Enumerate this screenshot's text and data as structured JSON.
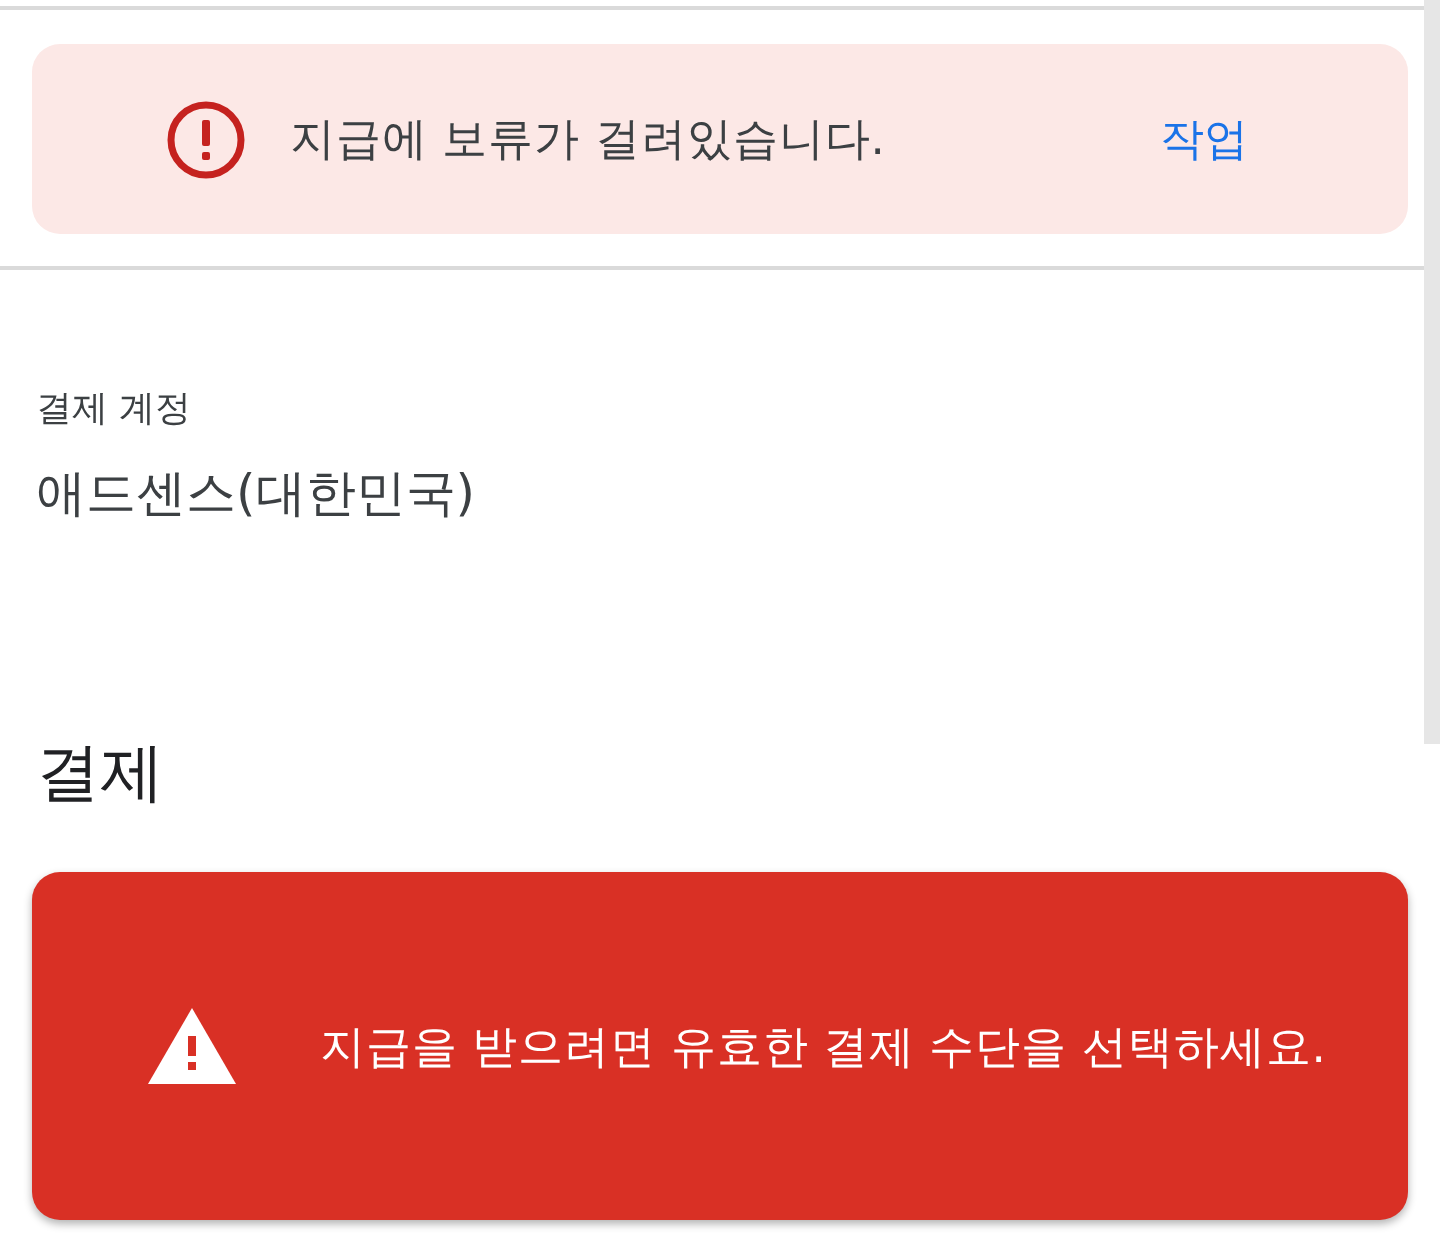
{
  "notice": {
    "kind": "hold",
    "message": "지급에 보류가 걸려있습니다.",
    "action": "작업"
  },
  "account": {
    "label": "결제 계정",
    "value": "애드센스(대한민국)"
  },
  "payment": {
    "heading": "결제",
    "notice": {
      "kind": "error",
      "message": "지급을 받으려면 유효한 결제 수단을 선택하세요."
    }
  }
}
